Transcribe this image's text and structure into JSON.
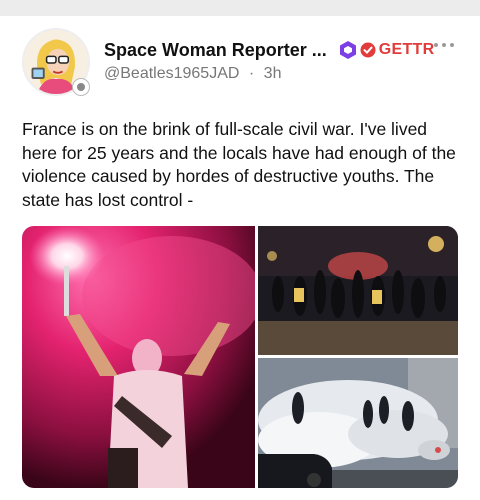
{
  "post": {
    "author": {
      "display_name": "Space Woman Reporter ...",
      "handle": "@Beatles1965JAD",
      "separator": "·",
      "time": "3h",
      "avatar_icon": "cartoon-reporter-avatar"
    },
    "platform": {
      "logo_text": "GETTR",
      "logo_color": "#e23b3b",
      "badge_colors": [
        "#7b3fe4",
        "#e23b3b"
      ]
    },
    "more_icon": "more-horizontal-icon",
    "text": "France is on the brink of full-scale civil war. I've lived here for 25 years and the locals have had enough of the violence caused by hordes of destructive youths. The state has lost control -",
    "media": [
      {
        "position": "left",
        "description_icon": "protester-flare-photo"
      },
      {
        "position": "top-right",
        "description_icon": "night-crowd-photo"
      },
      {
        "position": "bottom-right",
        "description_icon": "tear-gas-street-photo"
      }
    ]
  }
}
